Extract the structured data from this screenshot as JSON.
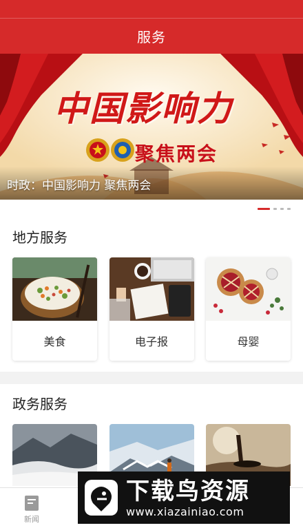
{
  "header": {
    "title": "服务"
  },
  "banner": {
    "headline": "中国影响力",
    "subline": "聚焦两会",
    "caption": "时政：中国影响力 聚焦两会",
    "page_count": 4,
    "active_page": 1
  },
  "local_services": {
    "title": "地方服务",
    "items": [
      {
        "label": "美食",
        "image": "food-photo"
      },
      {
        "label": "电子报",
        "image": "desk-newspaper-photo"
      },
      {
        "label": "母婴",
        "image": "pastry-photo"
      }
    ]
  },
  "gov_services": {
    "title": "政务服务",
    "items": [
      {
        "image": "mountain-clouds-photo"
      },
      {
        "image": "snowy-summit-hiker-photo"
      },
      {
        "image": "sunset-surfer-photo"
      }
    ]
  },
  "tabbar": {
    "items": [
      {
        "label": "新闻",
        "icon": "news-icon"
      }
    ]
  },
  "watermark": {
    "title": "下载鸟资源",
    "url": "www.xiazainiao.com"
  },
  "colors": {
    "brand_red": "#d62a2a",
    "accent_red": "#d01818"
  }
}
